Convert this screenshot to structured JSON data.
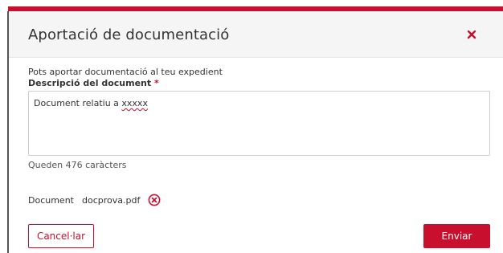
{
  "modal": {
    "title": "Aportació de documentació",
    "close_icon": "close-x-icon"
  },
  "form": {
    "intro": "Pots aportar documentació al teu expedient",
    "description_label": "Descripció del document",
    "required_mark": "*",
    "description_value_prefix": "Document relatiu a ",
    "description_value_flagged": "xxxxx",
    "remaining_chars": "Queden 476 caràcters"
  },
  "document": {
    "label": "Document",
    "file_name": "docprova.pdf",
    "remove_icon": "circle-x-icon"
  },
  "buttons": {
    "cancel": "Cancel·lar",
    "send": "Enviar"
  },
  "colors": {
    "accent": "#c8102e",
    "header_bg": "#f5f5f5",
    "border": "#cccccc"
  }
}
